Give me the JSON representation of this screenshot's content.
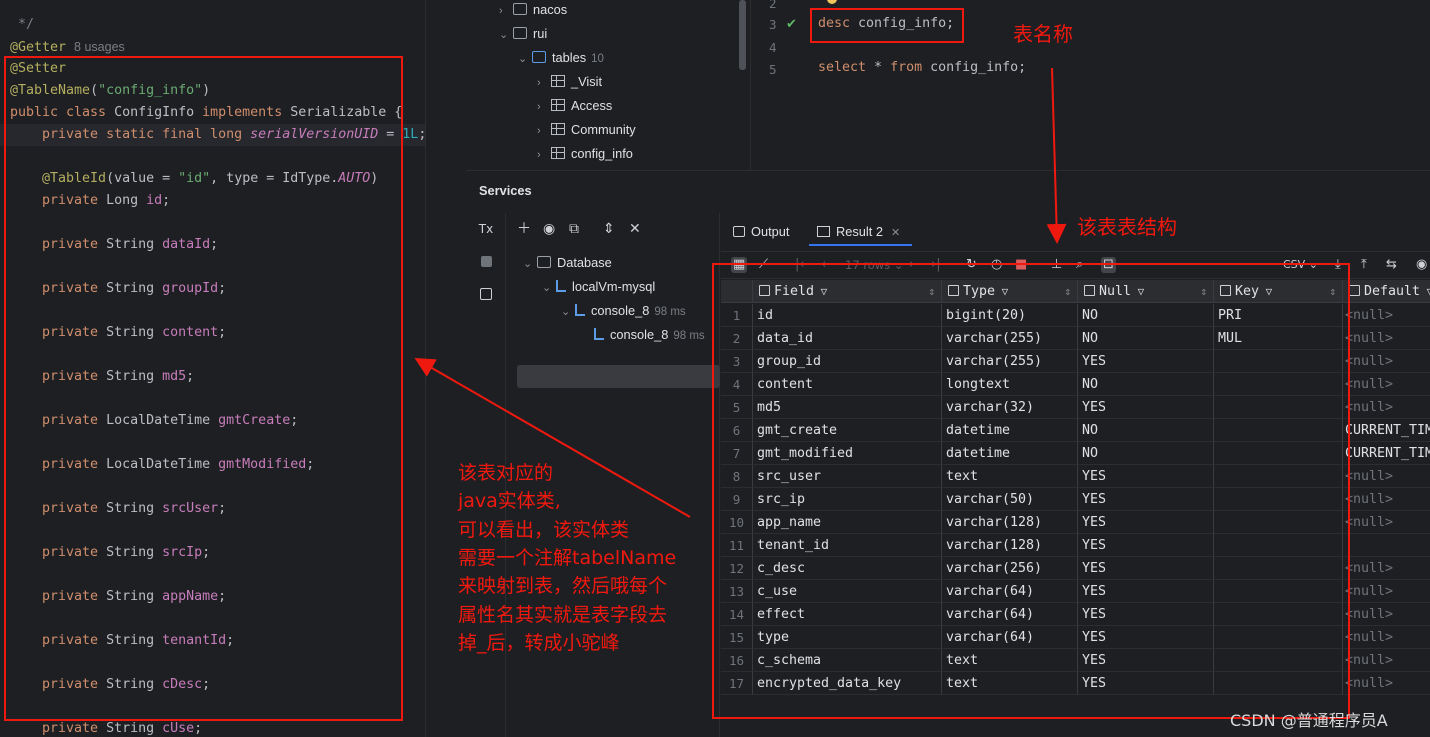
{
  "editor": {
    "lines": [
      {
        "parts": [
          {
            "t": " */",
            "c": "cmt"
          }
        ]
      },
      {
        "parts": [
          {
            "t": "@Getter",
            "c": "ann"
          }
        ],
        "usages": "8 usages"
      },
      {
        "parts": [
          {
            "t": "@Setter",
            "c": "ann"
          }
        ]
      },
      {
        "parts": [
          {
            "t": "@TableName",
            "c": "ann"
          },
          {
            "t": "(",
            "c": ""
          },
          {
            "t": "\"config_info\"",
            "c": "str"
          },
          {
            "t": ")",
            "c": ""
          }
        ]
      },
      {
        "parts": [
          {
            "t": "public class ",
            "c": "kw"
          },
          {
            "t": "ConfigInfo ",
            "c": ""
          },
          {
            "t": "implements ",
            "c": "kw"
          },
          {
            "t": "Serializable {",
            "c": ""
          }
        ]
      },
      {
        "parts": [
          {
            "t": "    private static final long ",
            "c": "kw"
          },
          {
            "t": "serialVersionUID",
            "c": "fld ital"
          },
          {
            "t": " = ",
            "c": ""
          },
          {
            "t": "1L",
            "c": "num"
          },
          {
            "t": ";",
            "c": ""
          }
        ]
      },
      {
        "parts": [
          {
            "t": "",
            "c": ""
          }
        ]
      },
      {
        "parts": [
          {
            "t": "    @TableId",
            "c": "ann"
          },
          {
            "t": "(value = ",
            "c": ""
          },
          {
            "t": "\"id\"",
            "c": "str"
          },
          {
            "t": ", type = IdType.",
            "c": ""
          },
          {
            "t": "AUTO",
            "c": "fld ital"
          },
          {
            "t": ")",
            "c": ""
          }
        ]
      },
      {
        "parts": [
          {
            "t": "    private ",
            "c": "kw"
          },
          {
            "t": "Long ",
            "c": ""
          },
          {
            "t": "id",
            "c": "fld"
          },
          {
            "t": ";",
            "c": ""
          }
        ]
      },
      {
        "parts": [
          {
            "t": "",
            "c": ""
          }
        ]
      },
      {
        "parts": [
          {
            "t": "    private ",
            "c": "kw"
          },
          {
            "t": "String ",
            "c": ""
          },
          {
            "t": "dataId",
            "c": "fld"
          },
          {
            "t": ";",
            "c": ""
          }
        ]
      },
      {
        "parts": [
          {
            "t": "",
            "c": ""
          }
        ]
      },
      {
        "parts": [
          {
            "t": "    private ",
            "c": "kw"
          },
          {
            "t": "String ",
            "c": ""
          },
          {
            "t": "groupId",
            "c": "fld"
          },
          {
            "t": ";",
            "c": ""
          }
        ]
      },
      {
        "parts": [
          {
            "t": "",
            "c": ""
          }
        ]
      },
      {
        "parts": [
          {
            "t": "    private ",
            "c": "kw"
          },
          {
            "t": "String ",
            "c": ""
          },
          {
            "t": "content",
            "c": "fld"
          },
          {
            "t": ";",
            "c": ""
          }
        ]
      },
      {
        "parts": [
          {
            "t": "",
            "c": ""
          }
        ]
      },
      {
        "parts": [
          {
            "t": "    private ",
            "c": "kw"
          },
          {
            "t": "String ",
            "c": ""
          },
          {
            "t": "md5",
            "c": "fld"
          },
          {
            "t": ";",
            "c": ""
          }
        ]
      },
      {
        "parts": [
          {
            "t": "",
            "c": ""
          }
        ]
      },
      {
        "parts": [
          {
            "t": "    private ",
            "c": "kw"
          },
          {
            "t": "LocalDateTime ",
            "c": ""
          },
          {
            "t": "gmtCreate",
            "c": "fld"
          },
          {
            "t": ";",
            "c": ""
          }
        ]
      },
      {
        "parts": [
          {
            "t": "",
            "c": ""
          }
        ]
      },
      {
        "parts": [
          {
            "t": "    private ",
            "c": "kw"
          },
          {
            "t": "LocalDateTime ",
            "c": ""
          },
          {
            "t": "gmtModified",
            "c": "fld"
          },
          {
            "t": ";",
            "c": ""
          }
        ]
      },
      {
        "parts": [
          {
            "t": "",
            "c": ""
          }
        ]
      },
      {
        "parts": [
          {
            "t": "    private ",
            "c": "kw"
          },
          {
            "t": "String ",
            "c": ""
          },
          {
            "t": "srcUser",
            "c": "fld"
          },
          {
            "t": ";",
            "c": ""
          }
        ]
      },
      {
        "parts": [
          {
            "t": "",
            "c": ""
          }
        ]
      },
      {
        "parts": [
          {
            "t": "    private ",
            "c": "kw"
          },
          {
            "t": "String ",
            "c": ""
          },
          {
            "t": "srcIp",
            "c": "fld"
          },
          {
            "t": ";",
            "c": ""
          }
        ]
      },
      {
        "parts": [
          {
            "t": "",
            "c": ""
          }
        ]
      },
      {
        "parts": [
          {
            "t": "    private ",
            "c": "kw"
          },
          {
            "t": "String ",
            "c": ""
          },
          {
            "t": "appName",
            "c": "fld"
          },
          {
            "t": ";",
            "c": ""
          }
        ]
      },
      {
        "parts": [
          {
            "t": "",
            "c": ""
          }
        ]
      },
      {
        "parts": [
          {
            "t": "    private ",
            "c": "kw"
          },
          {
            "t": "String ",
            "c": ""
          },
          {
            "t": "tenantId",
            "c": "fld"
          },
          {
            "t": ";",
            "c": ""
          }
        ]
      },
      {
        "parts": [
          {
            "t": "",
            "c": ""
          }
        ]
      },
      {
        "parts": [
          {
            "t": "    private ",
            "c": "kw"
          },
          {
            "t": "String ",
            "c": ""
          },
          {
            "t": "cDesc",
            "c": "fld"
          },
          {
            "t": ";",
            "c": ""
          }
        ]
      },
      {
        "parts": [
          {
            "t": "",
            "c": ""
          }
        ]
      },
      {
        "parts": [
          {
            "t": "    private ",
            "c": "kw"
          },
          {
            "t": "String ",
            "c": ""
          },
          {
            "t": "cUse",
            "c": "fld"
          },
          {
            "t": ";",
            "c": ""
          }
        ]
      }
    ]
  },
  "tree_top": {
    "nodes": [
      {
        "label": "nacos",
        "chev": "›",
        "icon": "schema",
        "level": 1
      },
      {
        "label": "rui",
        "chev": "⌄",
        "icon": "schema",
        "level": 1
      },
      {
        "label": "tables",
        "chev": "⌄",
        "icon": "folder",
        "level": 2,
        "count": "10"
      },
      {
        "label": "_Visit",
        "chev": "›",
        "icon": "table",
        "level": 3
      },
      {
        "label": "Access",
        "chev": "›",
        "icon": "table",
        "level": 3
      },
      {
        "label": "Community",
        "chev": "›",
        "icon": "table",
        "level": 3
      },
      {
        "label": "config_info",
        "chev": "›",
        "icon": "table",
        "level": 3
      }
    ]
  },
  "sql_editor": {
    "gutter": [
      "2",
      "3",
      "4",
      "5"
    ],
    "line3": {
      "kw": "desc",
      "rest": " config_info;"
    },
    "line5": {
      "kw1": "select",
      "mid": " * ",
      "kw2": "from",
      "rest": " config_info;"
    }
  },
  "services": {
    "title": "Services",
    "tree": [
      {
        "label": "Database",
        "chev": "⌄",
        "level": 0
      },
      {
        "label": "localVm-mysql",
        "chev": "⌄",
        "level": 1
      },
      {
        "label": "console_8",
        "chev": "⌄",
        "level": 2,
        "time": "98 ms"
      },
      {
        "label": "console_8",
        "chev": "",
        "level": 3,
        "time": "98 ms",
        "selected": true
      }
    ],
    "tabs": {
      "output": "Output",
      "result": "Result 2"
    },
    "rows_label": "17 rows",
    "export_label": "CSV"
  },
  "grid": {
    "columns": [
      "Field",
      "Type",
      "Null",
      "Key",
      "Default"
    ],
    "rows": [
      [
        "1",
        "id",
        "bigint(20)",
        "NO",
        "PRI",
        "<null>"
      ],
      [
        "2",
        "data_id",
        "varchar(255)",
        "NO",
        "MUL",
        "<null>"
      ],
      [
        "3",
        "group_id",
        "varchar(255)",
        "YES",
        "",
        "<null>"
      ],
      [
        "4",
        "content",
        "longtext",
        "NO",
        "",
        "<null>"
      ],
      [
        "5",
        "md5",
        "varchar(32)",
        "YES",
        "",
        "<null>"
      ],
      [
        "6",
        "gmt_create",
        "datetime",
        "NO",
        "",
        "CURRENT_TIM"
      ],
      [
        "7",
        "gmt_modified",
        "datetime",
        "NO",
        "",
        "CURRENT_TIM"
      ],
      [
        "8",
        "src_user",
        "text",
        "YES",
        "",
        "<null>"
      ],
      [
        "9",
        "src_ip",
        "varchar(50)",
        "YES",
        "",
        "<null>"
      ],
      [
        "10",
        "app_name",
        "varchar(128)",
        "YES",
        "",
        "<null>"
      ],
      [
        "11",
        "tenant_id",
        "varchar(128)",
        "YES",
        "",
        ""
      ],
      [
        "12",
        "c_desc",
        "varchar(256)",
        "YES",
        "",
        "<null>"
      ],
      [
        "13",
        "c_use",
        "varchar(64)",
        "YES",
        "",
        "<null>"
      ],
      [
        "14",
        "effect",
        "varchar(64)",
        "YES",
        "",
        "<null>"
      ],
      [
        "15",
        "type",
        "varchar(64)",
        "YES",
        "",
        "<null>"
      ],
      [
        "16",
        "c_schema",
        "text",
        "YES",
        "",
        "<null>"
      ],
      [
        "17",
        "encrypted_data_key",
        "text",
        "YES",
        "",
        "<null>"
      ]
    ]
  },
  "annotations": {
    "table_name": "表名称",
    "table_structure": "该表表结构",
    "entity_note": [
      "该表对应的",
      "java实体类,",
      "可以看出，该实体类",
      "需要一个注解tabelName",
      "来映射到表，然后哦每个",
      "属性名其实就是表字段去",
      "掉_后，转成小驼峰"
    ]
  },
  "watermark": "CSDN @普通程序员A",
  "colors": {
    "annotation_red": "#f0190f",
    "accent_blue": "#3574f0",
    "bg": "#1e1f22"
  }
}
